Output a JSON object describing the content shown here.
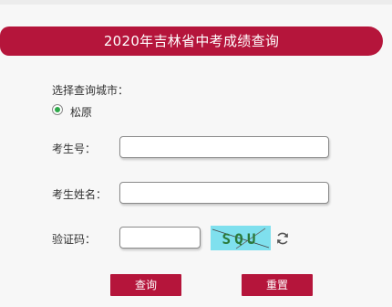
{
  "header": {
    "title": "2020年吉林省中考成绩查询"
  },
  "city_select": {
    "label": "选择查询城市：",
    "options": [
      "松原"
    ],
    "selected": "松原"
  },
  "form": {
    "exam_no_label": "考生号：",
    "exam_no_value": "",
    "name_label": "考生姓名：",
    "name_value": "",
    "captcha_label": "验证码：",
    "captcha_value": "",
    "captcha_text": "SQU"
  },
  "buttons": {
    "query": "查询",
    "reset": "重置"
  },
  "colors": {
    "accent": "#b5153b",
    "radio_selected": "#2ea84a",
    "captcha_bg": "#7fe0ee",
    "captcha_text": "#2a7a3a"
  },
  "icons": {
    "refresh": "refresh-icon"
  }
}
